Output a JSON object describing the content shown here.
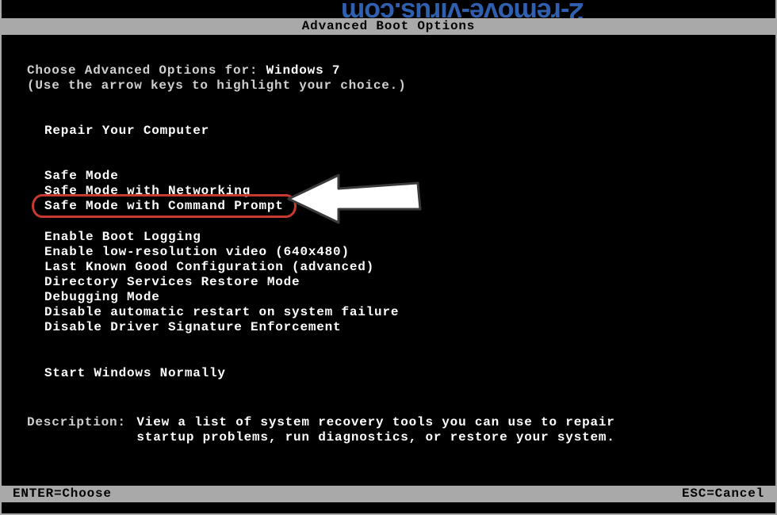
{
  "watermark": "2-remove-virus.com",
  "title": "Advanced Boot Options",
  "intro": {
    "prefix": "Choose Advanced Options for: ",
    "os": "Windows 7",
    "hint": "(Use the arrow keys to highlight your choice.)"
  },
  "options": {
    "repair": "Repair Your Computer",
    "safe": "Safe Mode",
    "safe_net": "Safe Mode with Networking",
    "safe_cmd": "Safe Mode with Command Prompt",
    "boot_log": "Enable Boot Logging",
    "lowres": "Enable low-resolution video (640x480)",
    "lkgc": "Last Known Good Configuration (advanced)",
    "dsrm": "Directory Services Restore Mode",
    "debug": "Debugging Mode",
    "noautorestart": "Disable automatic restart on system failure",
    "nodrvsig": "Disable Driver Signature Enforcement",
    "normal": "Start Windows Normally"
  },
  "description": {
    "label": "Description:",
    "line1": "View a list of system recovery tools you can use to repair",
    "line2": "startup problems, run diagnostics, or restore your system."
  },
  "footer": {
    "enter": "ENTER=Choose",
    "esc": "ESC=Cancel"
  },
  "annotation": {
    "highlight_target": "safe_cmd",
    "arrow_points_to": "safe_cmd",
    "ring_color": "#c83a2f"
  }
}
